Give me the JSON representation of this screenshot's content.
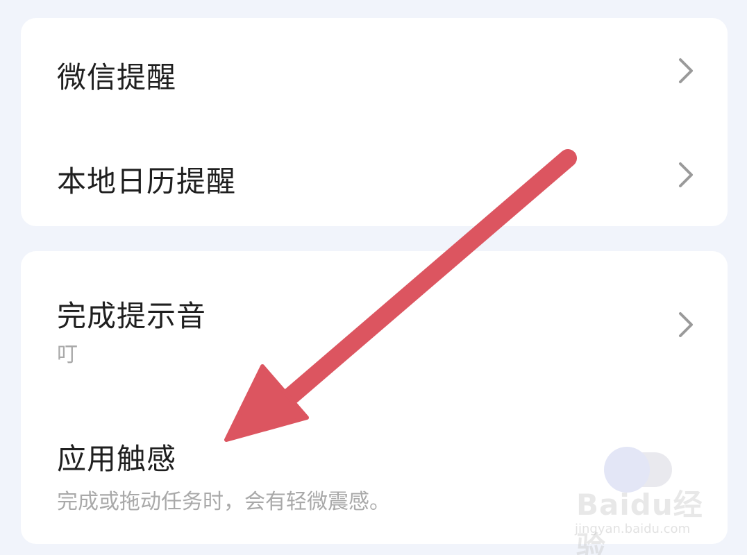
{
  "settings": {
    "group1": [
      {
        "title": "微信提醒"
      },
      {
        "title": "本地日历提醒"
      }
    ],
    "completion_sound": {
      "title": "完成提示音",
      "value": "叮"
    },
    "haptics": {
      "title": "应用触感",
      "description": "完成或拖动任务时，会有轻微震感。",
      "enabled": false
    }
  },
  "annotation": {
    "arrow_color": "#dc5560"
  },
  "watermark": {
    "brand": "Baidu经验",
    "url": "jingyan.baidu.com"
  },
  "colors": {
    "background": "#f1f4fb",
    "card": "#ffffff",
    "title_text": "#1f1f1f",
    "secondary_text": "#a9a9a9",
    "chevron": "#9a9a9a"
  }
}
